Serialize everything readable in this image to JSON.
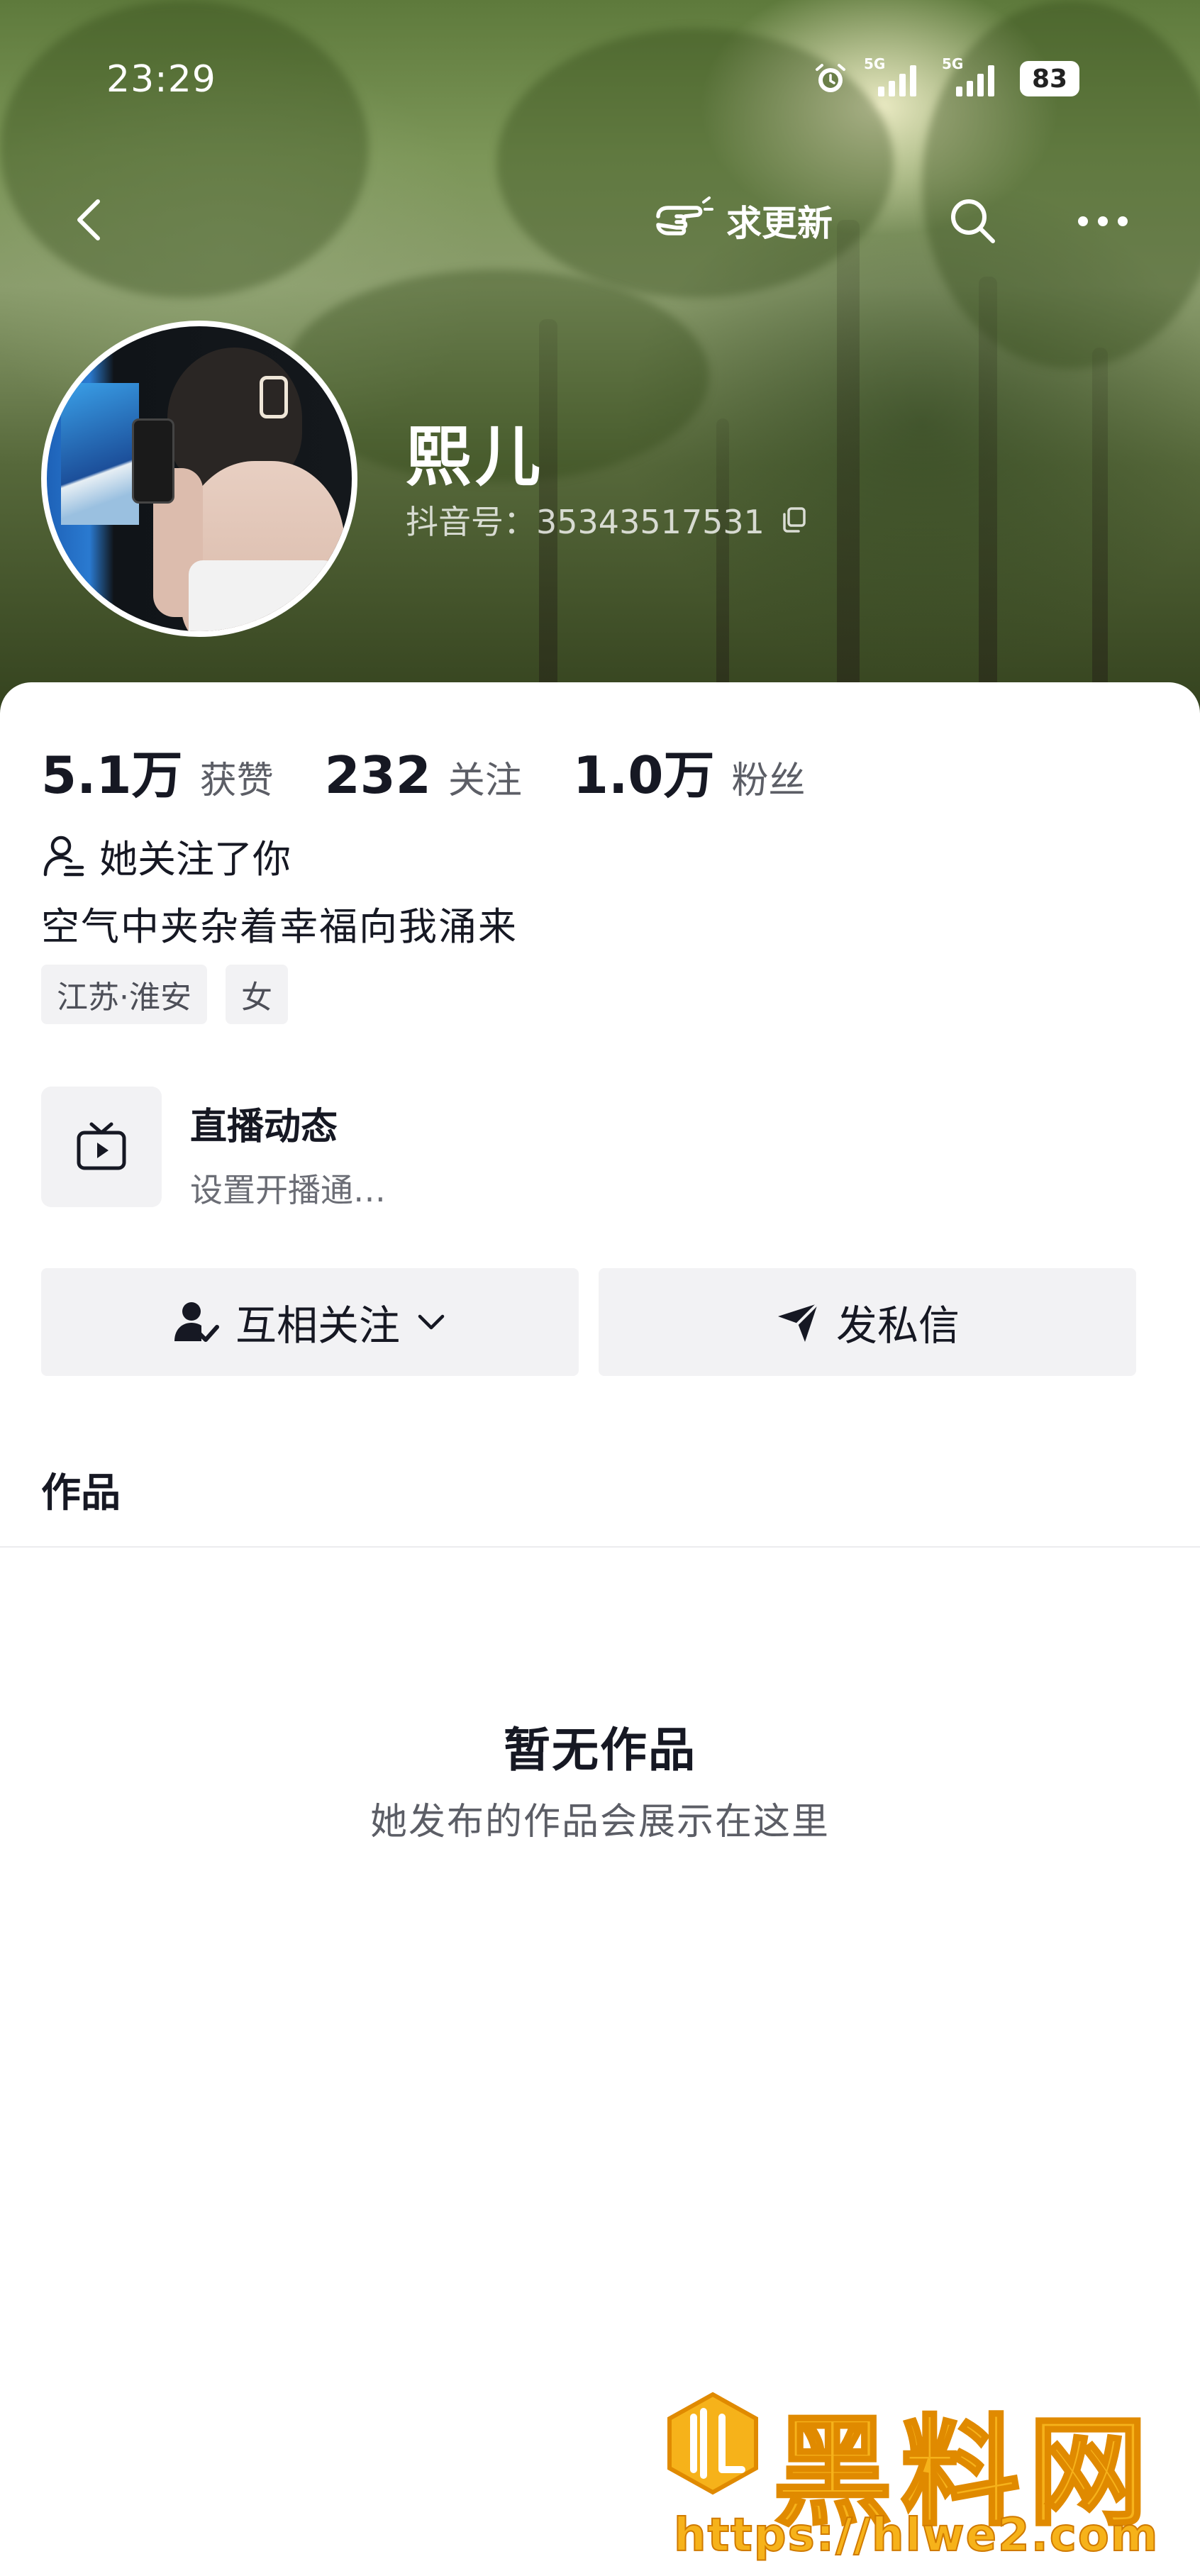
{
  "status_bar": {
    "time": "23:29",
    "network_1": "5G",
    "network_2": "5G",
    "battery": "83"
  },
  "topnav": {
    "update_label": "求更新"
  },
  "profile": {
    "nickname": "熙儿",
    "douyin_id": "抖音号：35343517531",
    "stats": [
      {
        "value": "5.1万",
        "label": "获赞"
      },
      {
        "value": "232",
        "label": "关注"
      },
      {
        "value": "1.0万",
        "label": "粉丝"
      }
    ],
    "follows_you": "她关注了你",
    "bio": "空气中夹杂着幸福向我涌来",
    "tags": [
      "江苏·淮安",
      "女"
    ]
  },
  "live": {
    "title": "直播动态",
    "subtitle": "设置开播通…"
  },
  "actions": {
    "mutual_follow": "互相关注",
    "message": "发私信"
  },
  "tabs": {
    "works": "作品"
  },
  "empty_state": {
    "title": "暂无作品",
    "subtitle": "她发布的作品会展示在这里"
  },
  "watermark": {
    "brand": "黑料网",
    "url": "https://hlwe2.com"
  }
}
